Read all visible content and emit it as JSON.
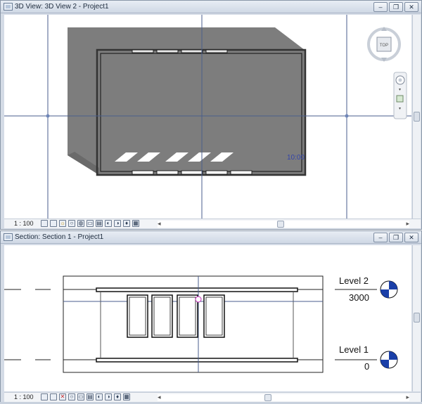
{
  "top_view": {
    "title": "3D View: 3D View 2 - Project1",
    "scale": "1 : 100",
    "time_label": "10:00",
    "viewcube_face": "TOP",
    "icons": [
      "app-icon",
      "minimize-icon",
      "restore-icon",
      "close-icon",
      "viewcube-icon",
      "steering-wheel-icon",
      "zoom-icon"
    ]
  },
  "bottom_view": {
    "title": "Section: Section 1 - Project1",
    "scale": "1 : 100",
    "levels": [
      {
        "name": "Level 2",
        "elevation": "3000"
      },
      {
        "name": "Level 1",
        "elevation": "0"
      }
    ],
    "level_head_colors": [
      "#1a3fa8",
      "#ffffff"
    ]
  },
  "window_buttons": {
    "minimize": "–",
    "restore": "❐",
    "close": "✕"
  },
  "colors": {
    "roof_gray": "#7d7d7d",
    "wall_dark": "#404040",
    "grid_line": "#4a5e8c",
    "time_text": "#3344aa",
    "level_marker": "#1a3fa8"
  }
}
